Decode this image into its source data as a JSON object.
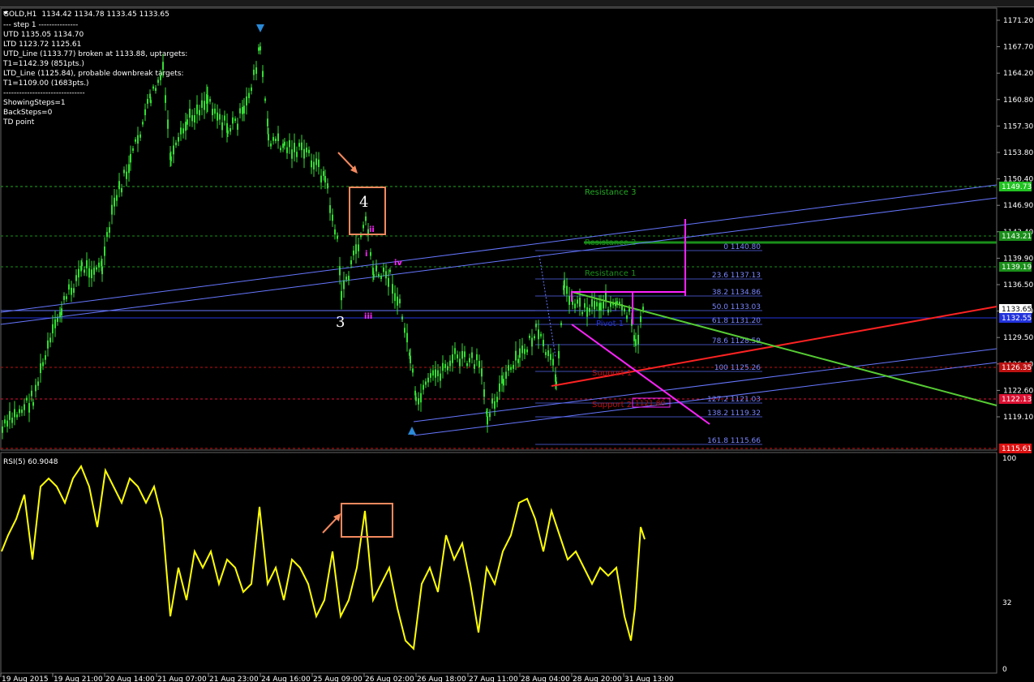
{
  "window": {
    "title": "GOLD,H1",
    "ohlc": "1134.42 1134.78 1133.45 1133.65"
  },
  "info_lines": [
    "---   step 1  ---------------",
    "UTD  1135.05  1134.70",
    "LTD  1123.72  1125.61",
    "UTD_Line (1133.77) broken at 1133.88, uptargets:",
    "T1=1142.39 (851pts.)",
    "LTD_Line (1125.84), probable downbreak targets:",
    "T1=1109.00 (1683pts.)",
    "-------------------------------",
    "ShowingSteps=1",
    "BackSteps=0",
    "TD point"
  ],
  "price_axis": {
    "ticks": [
      "1171.20",
      "1167.70",
      "1164.20",
      "1160.80",
      "1157.30",
      "1153.80",
      "1150.40",
      "1146.90",
      "1143.40",
      "1139.90",
      "1136.50",
      "1133.00",
      "1129.50",
      "1126.10",
      "1122.60",
      "1119.10"
    ],
    "markers": [
      {
        "label": "1149.73",
        "color": "#22c322"
      },
      {
        "label": "1143.21",
        "color": "#1a8f1a"
      },
      {
        "label": "1139.19",
        "color": "#1a8f1a"
      },
      {
        "label": "1133.65",
        "color": "#ffffff"
      },
      {
        "label": "1132.55",
        "color": "#2233dd"
      },
      {
        "label": "1126.35",
        "color": "#bb1111"
      },
      {
        "label": "1122.13",
        "color": "#dd1133"
      },
      {
        "label": "1115.61",
        "color": "#dd1111"
      }
    ]
  },
  "levels": {
    "resistance_3": "Resistance 3",
    "resistance_2": "Resistance 2",
    "resistance_1": "Resistance 1",
    "support_1": "Support 1",
    "support_2": "Support 2",
    "pivot": "Pivot 1",
    "support_2_value": "1121.80"
  },
  "fib_labels": [
    "0  1140.80",
    "23.6  1137.13",
    "38.2  1134.86",
    "50.0  1133.03",
    "61.8  1131.20",
    "78.6  1128.59",
    "100  1125.26",
    "127.2  1121.03",
    "138.2  1119.32",
    "161.8  1115.66"
  ],
  "wave_labels": {
    "four": "4",
    "three": "3",
    "ii": "ii",
    "i": "i",
    "iv": "iv",
    "iii": "iii"
  },
  "rsi": {
    "title": "RSI(5) 60.9048",
    "axis_top": "100",
    "axis_mid": "32",
    "axis_bottom": "0"
  },
  "time_axis": [
    "19 Aug 2015",
    "19 Aug 21:00",
    "20 Aug 14:00",
    "21 Aug 07:00",
    "21 Aug 23:00",
    "24 Aug 16:00",
    "25 Aug 09:00",
    "26 Aug 02:00",
    "26 Aug 18:00",
    "27 Aug 11:00",
    "28 Aug 04:00",
    "28 Aug 20:00",
    "31 Aug 13:00"
  ],
  "colors": {
    "candles": "#33dd33",
    "rsi_line": "#ffff00",
    "annotation": "#f4895f",
    "channel": "#6677ff",
    "resistance": "#22aa22",
    "support": "#cc1111",
    "magenta": "#ff22ff",
    "uptrend": "#ff2222",
    "downtrend": "#55cc33"
  }
}
